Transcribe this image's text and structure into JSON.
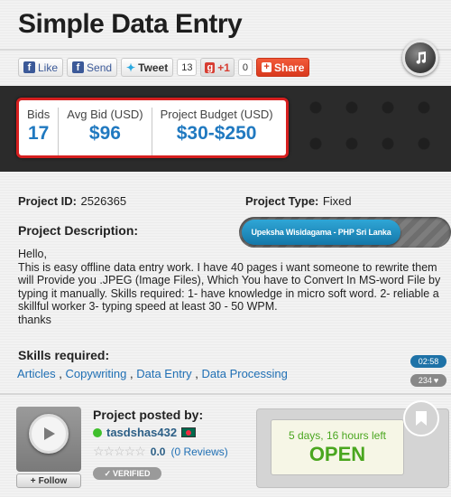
{
  "page": {
    "title": "Simple Data Entry"
  },
  "share": {
    "like_label": "Like",
    "send_label": "Send",
    "tweet_label": "Tweet",
    "tweet_count": "13",
    "gplus_label": "+1",
    "gplus_count": "0",
    "share_label": "Share"
  },
  "stats": {
    "bids_label": "Bids",
    "bids_value": "17",
    "avg_bid_label": "Avg Bid (USD)",
    "avg_bid_value": "$96",
    "budget_label": "Project Budget (USD)",
    "budget_value": "$30-$250"
  },
  "project": {
    "id_label": "Project ID:",
    "id_value": "2526365",
    "type_label": "Project Type:",
    "type_value": "Fixed",
    "description_label": "Project Description:",
    "description_lines": [
      "Hello,",
      "This is easy offline data entry work. I have 40 pages i want someone to rewrite them",
      "will Provide you .JPEG (Image Files), Which You have to Convert In MS-word File by",
      "typing it manually. Skills required: 1- have knowledge in micro soft word. 2- reliable a",
      "skillful worker 3- typing speed at least 30 - 50 WPM.",
      "thanks"
    ],
    "skills_label": "Skills required:",
    "skills": [
      "Articles",
      "Copywriting",
      "Data Entry",
      "Data Processing"
    ],
    "skills_separator": " , "
  },
  "user_pill": {
    "label": "Upeksha Wisidagama - PHP Sri Lanka"
  },
  "badges": {
    "time": "02:58",
    "views": "234"
  },
  "poster": {
    "posted_by_label": "Project posted by:",
    "name": "tasdshas432",
    "rating": "0.0",
    "reviews": "(0 Reviews)",
    "verified_label": "VERIFIED",
    "follow_label": "Follow"
  },
  "status": {
    "time_left": "5 days, 16 hours left",
    "state": "OPEN"
  },
  "colors": {
    "accent_blue": "#2079c0",
    "alert_red": "#d61f1f",
    "open_green": "#4aa61f",
    "link_blue": "#1f6fb4"
  },
  "icons": {
    "music": "music-note-icon",
    "play": "play-icon",
    "bookmark": "bookmark-icon",
    "heart": "heart-icon"
  }
}
